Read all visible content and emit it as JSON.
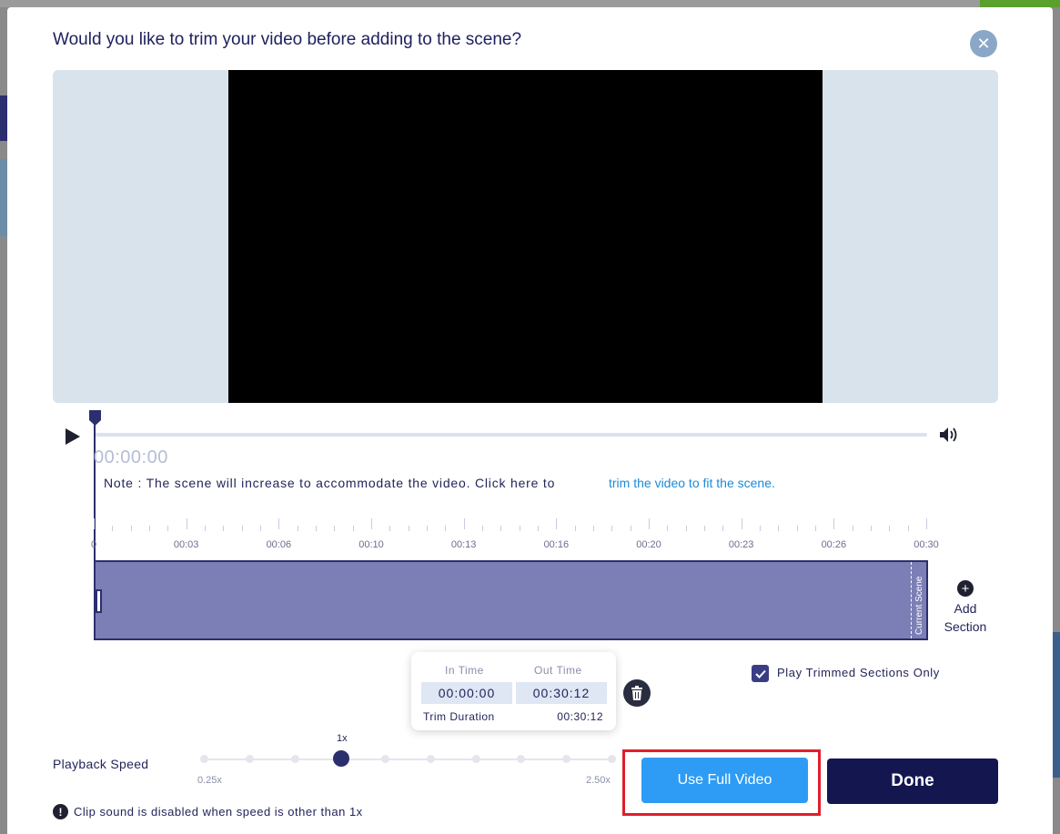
{
  "modal": {
    "title": "Would you like to trim your video before adding to the scene?",
    "close_icon": "close-icon"
  },
  "player": {
    "timecode": "00:00:00",
    "play_icon": "play-icon",
    "volume_icon": "volume-icon"
  },
  "note": {
    "text": "Note : The scene will increase to accommodate the video. Click here to",
    "link": "trim the video to fit the scene."
  },
  "ruler": {
    "labels": [
      "0",
      "00:03",
      "00:06",
      "00:10",
      "00:13",
      "00:16",
      "00:20",
      "00:23",
      "00:26",
      "00:30"
    ]
  },
  "timeline": {
    "scene_label": "Current Scene"
  },
  "add_section": {
    "label": "Add Section"
  },
  "trim_popup": {
    "in_label": "In Time",
    "out_label": "Out Time",
    "in_value": "00:00:00",
    "out_value": "00:30:12",
    "duration_label": "Trim Duration",
    "duration_value": "00:30:12"
  },
  "play_trimmed": {
    "label": "Play Trimmed Sections Only",
    "checked": true
  },
  "playback_speed": {
    "label": "Playback Speed",
    "current": "1x",
    "min": "0.25x",
    "max": "2.50x",
    "steps": 10,
    "selected_index": 3
  },
  "warning": {
    "text": "Clip sound is disabled when speed is other than 1x"
  },
  "buttons": {
    "use_full": "Use Full Video",
    "done": "Done"
  },
  "colors": {
    "accent": "#2e9cf5",
    "primary_dark": "#141650",
    "timeline_fill": "#7b7fb5",
    "highlight": "#e01e2b"
  }
}
